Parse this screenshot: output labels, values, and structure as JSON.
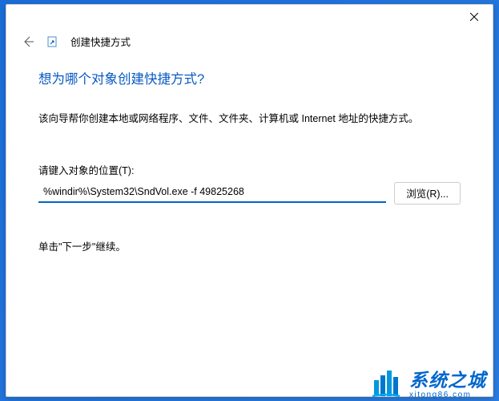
{
  "window": {
    "title": "创建快捷方式"
  },
  "content": {
    "heading": "想为哪个对象创建快捷方式?",
    "description": "该向导帮你创建本地或网络程序、文件、文件夹、计算机或 Internet 地址的快捷方式。",
    "input_label": "请键入对象的位置(T):",
    "location_value": "%windir%\\System32\\SndVol.exe -f 49825268",
    "browse_label": "浏览(R)...",
    "instruction": "单击\"下一步\"继续。"
  },
  "watermark": {
    "main": "系统之城",
    "sub": "xitong86.com"
  }
}
